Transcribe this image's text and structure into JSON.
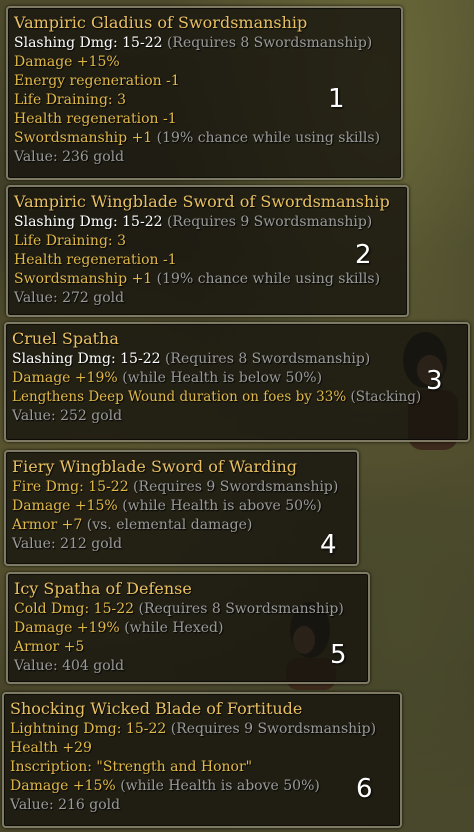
{
  "items": [
    {
      "number": "1",
      "title": "Vampiric Gladius of Swordsmanship",
      "lines": [
        {
          "main": "Slashing Dmg: 15-22",
          "note": " (Requires 8 Swordsmanship)",
          "style": "white"
        },
        {
          "main": "Damage +15%",
          "note": "",
          "style": "mod"
        },
        {
          "main": "Energy regeneration -1",
          "note": "",
          "style": "mod"
        },
        {
          "main": "Life Draining: 3",
          "note": "",
          "style": "mod"
        },
        {
          "main": "Health regeneration -1",
          "note": "",
          "style": "mod"
        },
        {
          "main": "Swordsmanship +1",
          "note": " (19% chance while using skills)",
          "style": "mod"
        }
      ],
      "value": "Value: 236 gold"
    },
    {
      "number": "2",
      "title": "Vampiric Wingblade Sword of Swordsmanship",
      "lines": [
        {
          "main": "Slashing Dmg: 15-22",
          "note": " (Requires 9 Swordsmanship)",
          "style": "white"
        },
        {
          "main": "Life Draining: 3",
          "note": "",
          "style": "mod"
        },
        {
          "main": "Health regeneration -1",
          "note": "",
          "style": "mod"
        },
        {
          "main": "Swordsmanship +1",
          "note": " (19% chance while using skills)",
          "style": "mod"
        }
      ],
      "value": "Value: 272 gold"
    },
    {
      "number": "3",
      "title": "Cruel Spatha",
      "lines": [
        {
          "main": "Slashing Dmg: 15-22",
          "note": " (Requires 8 Swordsmanship)",
          "style": "white"
        },
        {
          "main": "Damage +19%",
          "note": " (while Health is below 50%)",
          "style": "mod"
        },
        {
          "main": "Lengthens Deep Wound duration on foes by 33%",
          "note": " (Stacking)",
          "style": "mod"
        }
      ],
      "value": "Value: 252 gold"
    },
    {
      "number": "4",
      "title": "Fiery Wingblade Sword of Warding",
      "lines": [
        {
          "main": "Fire Dmg: 15-22",
          "note": " (Requires 9 Swordsmanship)",
          "style": "mod"
        },
        {
          "main": "Damage +15%",
          "note": " (while Health is above 50%)",
          "style": "mod"
        },
        {
          "main": "Armor +7",
          "note": " (vs. elemental damage)",
          "style": "mod"
        }
      ],
      "value": "Value: 212 gold"
    },
    {
      "number": "5",
      "title": "Icy Spatha of Defense",
      "lines": [
        {
          "main": "Cold Dmg: 15-22",
          "note": " (Requires 8 Swordsmanship)",
          "style": "mod"
        },
        {
          "main": "Damage +19%",
          "note": " (while Hexed)",
          "style": "mod"
        },
        {
          "main": "Armor +5",
          "note": "",
          "style": "mod"
        }
      ],
      "value": "Value: 404 gold"
    },
    {
      "number": "6",
      "title": "Shocking Wicked Blade of Fortitude",
      "lines": [
        {
          "main": "Lightning Dmg: 15-22",
          "note": " (Requires 9 Swordsmanship)",
          "style": "mod"
        },
        {
          "main": "Health +29",
          "note": "",
          "style": "mod"
        },
        {
          "main": "Inscription: \"Strength and Honor\"",
          "note": "",
          "style": "mod"
        },
        {
          "main": "Damage +15%",
          "note": " (while Health is above 50%)",
          "style": "mod"
        }
      ],
      "value": "Value: 216 gold"
    }
  ],
  "colors": {
    "title": "#e8c063",
    "modifier": "#e0b84a",
    "note": "#9a9a9a",
    "base": "#ffffff",
    "border": "#7f7a63"
  }
}
